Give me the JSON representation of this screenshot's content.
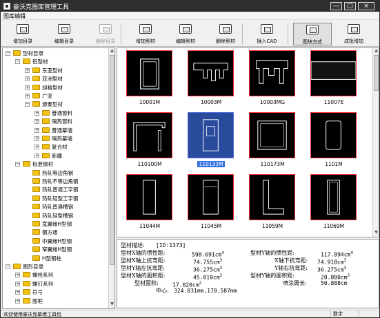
{
  "window": {
    "title": "豪沃克图库管理工具",
    "btn_min": "—",
    "btn_max": "□",
    "btn_close": "×"
  },
  "menu": {
    "item": "图库编辑"
  },
  "toolbar": [
    {
      "label": "增加目录",
      "icon": "folder-add-icon",
      "enabled": true
    },
    {
      "label": "编辑目录",
      "icon": "folder-edit-icon",
      "enabled": true
    },
    {
      "label": "删除目录",
      "icon": "folder-delete-icon",
      "enabled": false
    },
    {
      "label": "增加型材",
      "icon": "profile-add-icon",
      "enabled": true
    },
    {
      "label": "编辑型材",
      "icon": "profile-edit-icon",
      "enabled": true
    },
    {
      "label": "删除型材",
      "icon": "profile-delete-icon",
      "enabled": true
    },
    {
      "label": "插入CAD",
      "icon": "insert-cad-icon",
      "enabled": true
    },
    {
      "label": "图块方式",
      "icon": "block-mode-icon",
      "enabled": true,
      "active": true
    },
    {
      "label": "成批增加",
      "icon": "batch-add-icon",
      "enabled": true
    }
  ],
  "tree": [
    {
      "label": "型材目录",
      "level": 0,
      "exp": "−"
    },
    {
      "label": "铝型材",
      "level": 1,
      "exp": "−"
    },
    {
      "label": "东亚型材",
      "level": 2,
      "exp": "+"
    },
    {
      "label": "亚洲型材",
      "level": 2,
      "exp": "+"
    },
    {
      "label": "旭格型材",
      "level": 2,
      "exp": "+"
    },
    {
      "label": "广亚",
      "level": 2,
      "exp": "+"
    },
    {
      "label": "源泰型材",
      "level": 2,
      "exp": "−"
    },
    {
      "label": "普通窗料",
      "level": 3,
      "exp": "+"
    },
    {
      "label": "隔热窗料",
      "level": 3,
      "exp": "+"
    },
    {
      "label": "普通幕墙",
      "level": 3,
      "exp": "+"
    },
    {
      "label": "隔热幕墙",
      "level": 3,
      "exp": "+"
    },
    {
      "label": "复合材",
      "level": 3,
      "exp": "+"
    },
    {
      "label": "新疆",
      "level": 3,
      "exp": "+"
    },
    {
      "label": "标准钢材",
      "level": 1,
      "exp": "−"
    },
    {
      "label": "热轧等边角钢",
      "level": 2,
      "exp": ""
    },
    {
      "label": "热轧不等边角钢",
      "level": 2,
      "exp": ""
    },
    {
      "label": "热轧普通工字钢",
      "level": 2,
      "exp": ""
    },
    {
      "label": "热轧轻型工字钢",
      "level": 2,
      "exp": ""
    },
    {
      "label": "热轧普通槽钢",
      "level": 2,
      "exp": ""
    },
    {
      "label": "热轧轻型槽钢",
      "level": 2,
      "exp": ""
    },
    {
      "label": "宽翼缘H型钢",
      "level": 2,
      "exp": ""
    },
    {
      "label": "钢方通",
      "level": 2,
      "exp": ""
    },
    {
      "label": "中翼缘H型钢",
      "level": 2,
      "exp": ""
    },
    {
      "label": "窄翼缘H型钢",
      "level": 2,
      "exp": ""
    },
    {
      "label": "H型钢柱",
      "level": 2,
      "exp": ""
    },
    {
      "label": "图形目录",
      "level": 0,
      "exp": "−"
    },
    {
      "label": "螺栓系列",
      "level": 1,
      "exp": "+"
    },
    {
      "label": "螺钉系列",
      "level": 1,
      "exp": "+"
    },
    {
      "label": "符号",
      "level": 1,
      "exp": "+"
    },
    {
      "label": "图框",
      "level": 1,
      "exp": "+"
    }
  ],
  "thumbnails": [
    {
      "label": "10001M",
      "shape": "frameA"
    },
    {
      "label": "10003M",
      "shape": "comb"
    },
    {
      "label": "10003MG",
      "shape": "comb2"
    },
    {
      "label": "11007E",
      "shape": "bar"
    },
    {
      "label": "110100M",
      "shape": "frameB"
    },
    {
      "label": "110133M",
      "shape": "frameC",
      "selected": true
    },
    {
      "label": "110173M",
      "shape": "box"
    },
    {
      "label": "1101M",
      "shape": "rbox"
    },
    {
      "label": "11044M",
      "shape": "tall"
    },
    {
      "label": "11045M",
      "shape": "tall2"
    },
    {
      "label": "11059M",
      "shape": "L"
    },
    {
      "label": "11069M",
      "shape": "tall3"
    }
  ],
  "info": {
    "desc_label": "型材描述:",
    "desc_value": "[ID:1373]",
    "ix_label": "型材X轴的惯性距:",
    "ix_value": "598.691cm",
    "ix_exp": "4",
    "iy_label": "型材Y轴的惯性距:",
    "iy_value": "117.894cm",
    "iy_exp": "4",
    "wx_up_label": "型材X轴上抗弯距:",
    "wx_up_value": "74.755cm",
    "wx_up_exp": "3",
    "wx_dn_label": "X轴下抗弯距:",
    "wx_dn_value": "74.918cm",
    "wx_dn_exp": "3",
    "wy_l_label": "型材Y轴左抗弯距:",
    "wy_l_value": "36.275cm",
    "wy_l_exp": "3",
    "wy_r_label": "Y轴右抗弯距:",
    "wy_r_value": "36.275cm",
    "wy_r_exp": "3",
    "sx_label": "型材X轴的面积距:",
    "sx_value": "45.810cm",
    "sx_exp": "3",
    "sy_label": "型材Y轴的面积距:",
    "sy_value": "20.880cm",
    "sy_exp": "3",
    "area_label": "型材面积:",
    "area_value": "17.020cm",
    "area_exp": "2",
    "perim_label": "喷涂周长:",
    "perim_value": "50.888cm",
    "center_label": "中心:",
    "center_value": "324.031mm,170.587mm"
  },
  "status": {
    "message": "欢迎使用豪沃克幕墙工具包",
    "panel1": "数字"
  }
}
